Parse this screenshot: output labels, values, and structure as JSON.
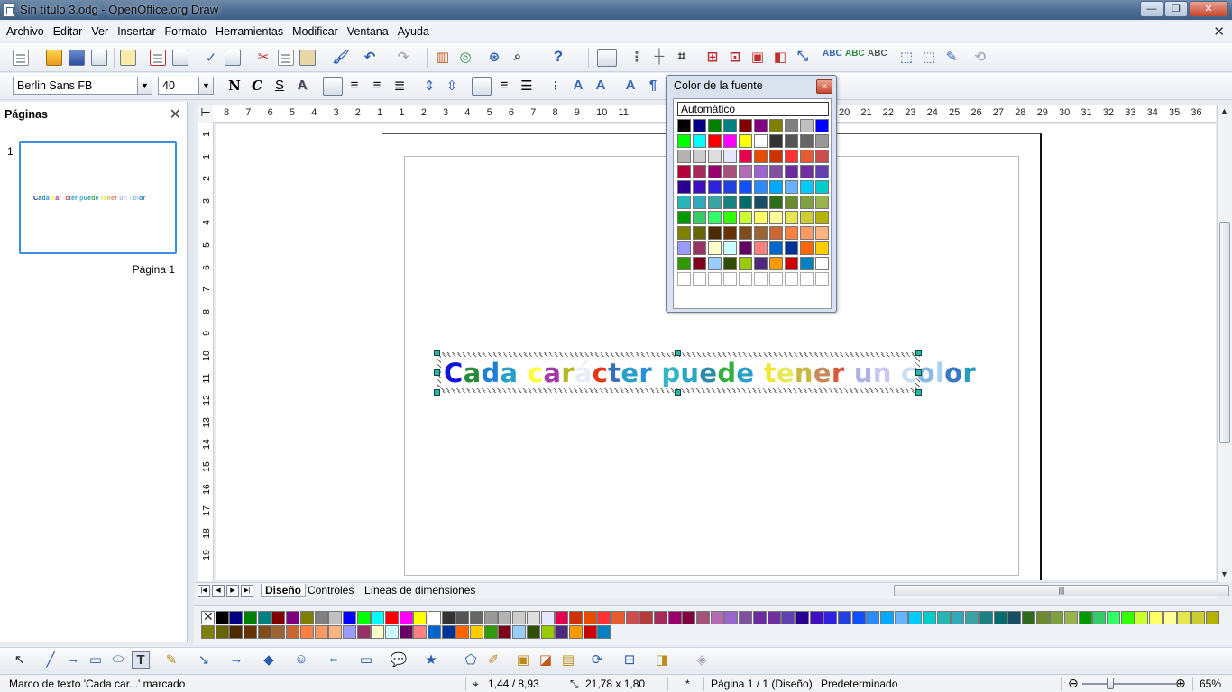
{
  "window": {
    "title": "Sin título 3.odg - OpenOffice.org Draw",
    "controls": {
      "minimize": "—",
      "maximize": "❐",
      "close": "✕"
    }
  },
  "menubar": {
    "items": [
      "Archivo",
      "Editar",
      "Ver",
      "Insertar",
      "Formato",
      "Herramientas",
      "Modificar",
      "Ventana",
      "Ayuda"
    ],
    "close_doc": "✕"
  },
  "format_toolbar": {
    "font_name": "Berlin Sans FB",
    "font_size": "40",
    "bold": "N",
    "italic": "C",
    "underline": "S",
    "shadow": "A"
  },
  "pages_pane": {
    "title": "Páginas",
    "close": "✕",
    "page_number": "1",
    "thumbnail_label": "Página 1",
    "thumbnail_text": "Cada carácter puede tener un color"
  },
  "rulers": {
    "horizontal": [
      "8",
      "7",
      "6",
      "5",
      "4",
      "3",
      "2",
      "1",
      "1",
      "2",
      "3",
      "4",
      "5",
      "6",
      "7",
      "8",
      "9",
      "10",
      "11",
      "20",
      "21",
      "22",
      "23",
      "24",
      "25",
      "26",
      "27",
      "28",
      "29",
      "30",
      "31",
      "32",
      "33",
      "34",
      "35",
      "36"
    ],
    "vertical": [
      "1",
      "1",
      "2",
      "3",
      "4",
      "5",
      "6",
      "7",
      "8",
      "9",
      "10",
      "11",
      "12",
      "13",
      "14",
      "15",
      "16",
      "17",
      "18",
      "19"
    ]
  },
  "document": {
    "text_frame_chars": [
      {
        "c": "C",
        "color": "#1414d8"
      },
      {
        "c": "a",
        "color": "#2a8c3a"
      },
      {
        "c": "d",
        "color": "#1f7fd6"
      },
      {
        "c": "a",
        "color": "#2aa0c8"
      },
      {
        "c": " ",
        "color": "#000000"
      },
      {
        "c": "c",
        "color": "#ffff33"
      },
      {
        "c": "a",
        "color": "#a03aa8"
      },
      {
        "c": "r",
        "color": "#b5b82a"
      },
      {
        "c": "á",
        "color": "#e8eef8"
      },
      {
        "c": "c",
        "color": "#e03a1a"
      },
      {
        "c": "t",
        "color": "#3a6fb8"
      },
      {
        "c": "e",
        "color": "#2aa0c8"
      },
      {
        "c": "r",
        "color": "#2a8fd6"
      },
      {
        "c": " ",
        "color": "#000000"
      },
      {
        "c": "p",
        "color": "#33b5c8"
      },
      {
        "c": "u",
        "color": "#2aa5c0"
      },
      {
        "c": "e",
        "color": "#2a8ca8"
      },
      {
        "c": "d",
        "color": "#35b040"
      },
      {
        "c": "e",
        "color": "#2aa0c8"
      },
      {
        "c": " ",
        "color": "#000000"
      },
      {
        "c": "t",
        "color": "#f0e830"
      },
      {
        "c": "e",
        "color": "#e8e858"
      },
      {
        "c": "n",
        "color": "#c8b840"
      },
      {
        "c": "e",
        "color": "#c88a5a"
      },
      {
        "c": "r",
        "color": "#d85a3a"
      },
      {
        "c": " ",
        "color": "#000000"
      },
      {
        "c": "u",
        "color": "#b0b0e8"
      },
      {
        "c": "n",
        "color": "#c8c8f0"
      },
      {
        "c": " ",
        "color": "#000000"
      },
      {
        "c": "c",
        "color": "#c8e0f0"
      },
      {
        "c": "o",
        "color": "#8ab8e8"
      },
      {
        "c": "l",
        "color": "#a8d0f0"
      },
      {
        "c": "o",
        "color": "#3a78c8"
      },
      {
        "c": "r",
        "color": "#2a9ab8"
      }
    ]
  },
  "tabs": {
    "nav": [
      "|◀",
      "◀",
      "▶",
      "▶|"
    ],
    "sheets": [
      "Diseño",
      "Controles",
      "Líneas de dimensiones"
    ],
    "scroll_grip": "|||"
  },
  "color_popup": {
    "title": "Color de la fuente",
    "close": "✕",
    "automatic_label": "Automático",
    "colors": [
      "#000000",
      "#000080",
      "#008000",
      "#008080",
      "#800000",
      "#800080",
      "#808000",
      "#808080",
      "#c0c0c0",
      "#0000ff",
      "#00ff00",
      "#00ffff",
      "#ff0000",
      "#ff00ff",
      "#ffff00",
      "#ffffff",
      "#333333",
      "#555555",
      "#666666",
      "#999999",
      "#b3b3b3",
      "#cccccc",
      "#dddddd",
      "#e6e6ff",
      "#e6004d",
      "#e64d00",
      "#cc3300",
      "#ff3333",
      "#e65c2e",
      "#cc4d4d",
      "#b3003d",
      "#a62a5c",
      "#99006b",
      "#a6527a",
      "#b36bb3",
      "#9966cc",
      "#8050a0",
      "#6a2aa0",
      "#7030a0",
      "#6040b0",
      "#2a0090",
      "#4010c0",
      "#3020e0",
      "#2040e0",
      "#1050ff",
      "#2e8bff",
      "#00a8ff",
      "#66b3ff",
      "#00ccff",
      "#00cccc",
      "#2ab5b5",
      "#33aabb",
      "#3aa3a3",
      "#1a8080",
      "#006b6b",
      "#1a4d66",
      "#2e6b1a",
      "#6b8c2e",
      "#80a040",
      "#99b34d",
      "#009900",
      "#33cc66",
      "#33ff66",
      "#33ff00",
      "#ccff33",
      "#ffff66",
      "#ffff99",
      "#e6e64d",
      "#cccc33",
      "#b3b300",
      "#808000",
      "#666600",
      "#4d2a00",
      "#663300",
      "#804d1a",
      "#996633",
      "#cc6633",
      "#ff8040",
      "#ff9966",
      "#ffb380",
      "#9999ff",
      "#993366",
      "#ffffcc",
      "#ccffff",
      "#660066",
      "#ff8080",
      "#0066cc",
      "#003399",
      "#ff6600",
      "#ffcc00",
      "#339900",
      "#800020",
      "#99ccff",
      "#334d00",
      "#99cc00",
      "#4d2a80",
      "#ff9900",
      "#cc0000",
      "#0080c0",
      "#ffffff",
      "",
      "",
      "",
      "",
      "",
      "",
      "",
      "",
      "",
      ""
    ]
  },
  "color_bar": {
    "colors": [
      "none",
      "#000000",
      "#000080",
      "#008000",
      "#008080",
      "#800000",
      "#800080",
      "#808000",
      "#808080",
      "#c0c0c0",
      "#0000ff",
      "#00ff00",
      "#00ffff",
      "#ff0000",
      "#ff00ff",
      "#ffff00",
      "#ffffff",
      "#333333",
      "#555555",
      "#666666",
      "#999999",
      "#b3b3b3",
      "#cccccc",
      "#dddddd",
      "#e6e6ff",
      "#e6004d",
      "#cc3300",
      "#e64d00",
      "#ff3333",
      "#e65c2e",
      "#cc4d4d",
      "#b33d3d",
      "#a62a5c",
      "#99006b",
      "#800040",
      "#a6527a",
      "#b36bb3",
      "#9966cc",
      "#8050a0",
      "#6a2aa0",
      "#7030a0",
      "#6040b0",
      "#2a0090",
      "#4010c0",
      "#3020e0",
      "#2040e0",
      "#1050ff",
      "#2e8bff",
      "#00a8ff",
      "#66b3ff",
      "#00ccff",
      "#00cccc",
      "#2ab5b5",
      "#33aabb",
      "#3aa3a3",
      "#1a8080",
      "#006b6b",
      "#1a4d66",
      "#2e6b1a",
      "#6b8c2e",
      "#80a040",
      "#99b34d",
      "#009900",
      "#33cc66",
      "#33ff66",
      "#33ff00",
      "#ccff33",
      "#ffff66",
      "#ffff99",
      "#e6e64d",
      "#cccc33",
      "#b3b300",
      "#808000",
      "#666600",
      "#4d2a00",
      "#663300",
      "#804d1a",
      "#996633",
      "#cc6633",
      "#ff8040",
      "#ff9966",
      "#ffb380",
      "#9999ff",
      "#993366",
      "#ffffcc",
      "#ccffff",
      "#660066",
      "#ff8080",
      "#0066cc",
      "#003399",
      "#ff6600",
      "#ffcc00",
      "#339900",
      "#800020",
      "#99ccff",
      "#334d00",
      "#99cc00",
      "#4d2a80",
      "#ff9900",
      "#cc0000",
      "#0080c0"
    ]
  },
  "statusbar": {
    "message": "Marco de texto 'Cada car...' marcado",
    "position": "1,44 / 8,93",
    "size": "21,78 x 1,80",
    "modified": "*",
    "page_info": "Página 1 / 1 (Diseño)",
    "style": "Predeterminado",
    "zoom_out": "⊖",
    "zoom_in": "⊕",
    "zoom": "65%"
  }
}
